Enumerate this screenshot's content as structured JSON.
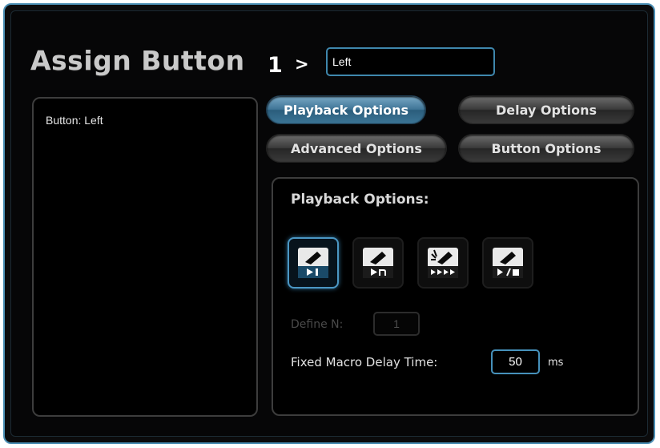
{
  "header": {
    "title": "Assign Button",
    "button_number": "1",
    "separator": ">",
    "name_value": "Left"
  },
  "left_panel": {
    "label": "Button: Left"
  },
  "tabs": [
    {
      "label": "Playback Options",
      "active": true
    },
    {
      "label": "Delay Options",
      "active": false
    },
    {
      "label": "Advanced Options",
      "active": false
    },
    {
      "label": "Button Options",
      "active": false
    }
  ],
  "playback": {
    "heading": "Playback Options:",
    "modes": [
      {
        "icon": "play-once-icon",
        "glyph": "▶1",
        "selected": true
      },
      {
        "icon": "play-n-times-icon",
        "glyph": "▶n",
        "selected": false
      },
      {
        "icon": "play-repeat-icon",
        "glyph": "▶▶▶▶",
        "selected": false
      },
      {
        "icon": "play-toggle-icon",
        "glyph": "▶/■",
        "selected": false
      }
    ],
    "define_n_label": "Define N:",
    "define_n_value": "1",
    "delay_label": "Fixed Macro Delay Time:",
    "delay_value": "50",
    "delay_unit": "ms"
  },
  "colors": {
    "accent": "#4b97c4",
    "background": "#000000",
    "active_tab": "#3f7597"
  }
}
